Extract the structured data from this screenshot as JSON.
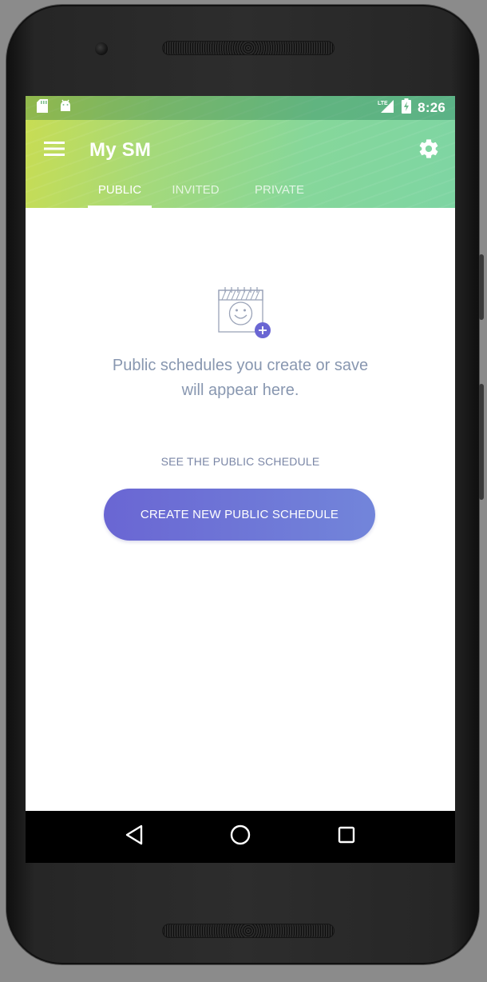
{
  "status_bar": {
    "time": "8:26",
    "network": "LTE",
    "icons": [
      "sd-card-icon",
      "android-icon",
      "lte-signal-icon",
      "battery-charging-icon"
    ]
  },
  "toolbar": {
    "title": "My SM",
    "menu_icon": "hamburger-menu-icon",
    "settings_icon": "gear-icon"
  },
  "tabs": [
    {
      "label": "PUBLIC",
      "active": true
    },
    {
      "label": "INVITED",
      "active": false
    },
    {
      "label": "PRIVATE",
      "active": false
    }
  ],
  "empty_state": {
    "icon": "calendar-smile-add-icon",
    "message_line1": "Public schedules you create or save",
    "message_line2": "will appear here.",
    "link_label": "SEE THE PUBLIC SCHEDULE",
    "button_label": "CREATE NEW PUBLIC SCHEDULE"
  },
  "nav_bar": {
    "back_icon": "back-triangle-icon",
    "home_icon": "home-circle-icon",
    "recents_icon": "recents-square-icon"
  },
  "colors": {
    "appbar_start": "#c9dd52",
    "appbar_end": "#7ed5a3",
    "button_start": "#6a66d3",
    "button_end": "#7285da",
    "text_muted": "#8897b0"
  }
}
